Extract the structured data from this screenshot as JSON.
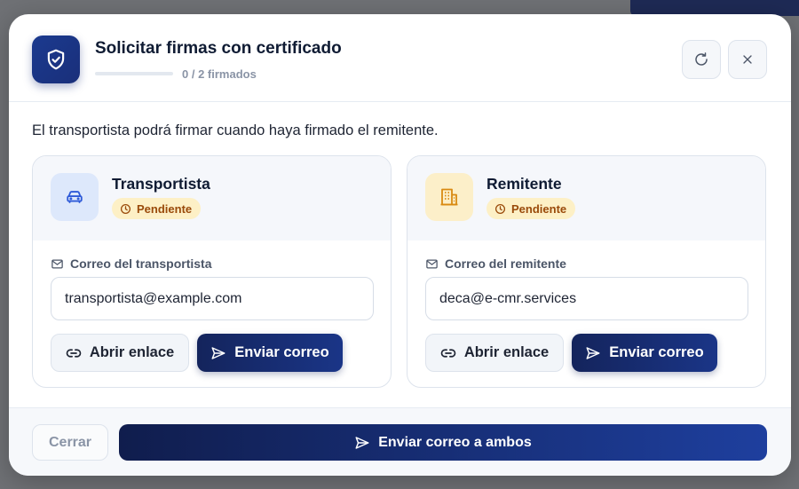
{
  "dialog": {
    "title": "Solicitar firmas con certificado",
    "progress_text": "0 / 2 firmados",
    "progress_fraction": 0,
    "icons": {
      "header": "shield-check-icon",
      "refresh": "refresh-icon",
      "close": "close-icon"
    }
  },
  "info_text": "El transportista podrá firmar cuando haya firmado el remitente.",
  "parties": [
    {
      "name": "Transportista",
      "icon": "car-icon",
      "status": "Pendiente",
      "status_icon": "clock-icon",
      "field_label": "Correo del transportista",
      "field_icon": "mail-icon",
      "email": "transportista@example.com",
      "open_link_label": "Abrir enlace",
      "send_email_label": "Enviar correo"
    },
    {
      "name": "Remitente",
      "icon": "building-icon",
      "status": "Pendiente",
      "status_icon": "clock-icon",
      "field_label": "Correo del remitente",
      "field_icon": "mail-icon",
      "email": "deca@e-cmr.services",
      "open_link_label": "Abrir enlace",
      "send_email_label": "Enviar correo"
    }
  ],
  "footer": {
    "cancel_label": "Cerrar",
    "send_both_label": "Enviar correo a ambos"
  },
  "colors": {
    "primary": "#1a2f7a",
    "pending_bg": "#fdf0c6",
    "pending_text": "#9a4a0a"
  }
}
